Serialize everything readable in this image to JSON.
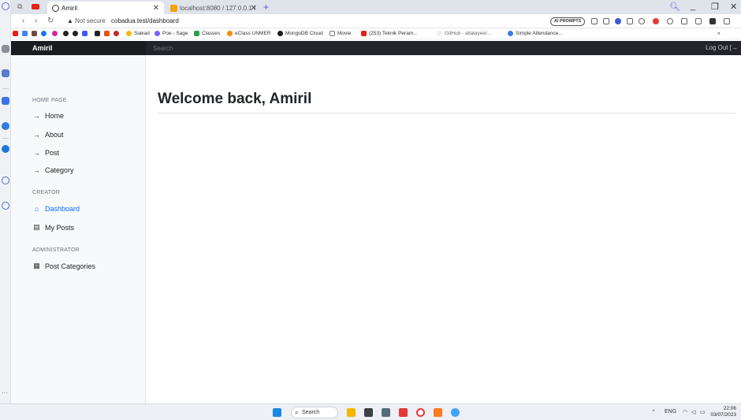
{
  "browser": {
    "tabs": [
      {
        "label": "Amiril",
        "active": true
      },
      {
        "label": "localhost:8080 / 127.0.0.1 /",
        "active": false
      }
    ],
    "address": {
      "security": "Not secure",
      "url": "cobadua.test/dashboard"
    },
    "ai_button": "AI PROMPTS",
    "bookmarks": [
      {
        "label": "Siakad",
        "color": "#f2b90f"
      },
      {
        "label": "Poe - Sage",
        "color": "#7b61ff"
      },
      {
        "label": "Classes",
        "color": "#2e9e44"
      },
      {
        "label": "eClass UNMER",
        "color": "#ff8a00"
      },
      {
        "label": "MongoDB Cloud",
        "color": "#1d1d1d"
      },
      {
        "label": "Movie",
        "color": "#777777"
      },
      {
        "label": "(253) Teknik Peram...",
        "color": "#e62117"
      },
      {
        "label": "GitHub - aliatayee/...",
        "color": "#cccccc"
      },
      {
        "label": "Simple Attendance...",
        "color": "#3d7be0"
      }
    ]
  },
  "app": {
    "brand": "Amiril",
    "search_placeholder": "Search",
    "logout": "Log Out",
    "sections": [
      {
        "heading": "HOME PAGE",
        "items": [
          {
            "label": "Home",
            "icon": "arrow-right-icon"
          },
          {
            "label": "About",
            "icon": "arrow-right-icon"
          },
          {
            "label": "Post",
            "icon": "arrow-right-icon"
          },
          {
            "label": "Category",
            "icon": "arrow-right-icon"
          }
        ]
      },
      {
        "heading": "CREATOR",
        "items": [
          {
            "label": "Dashboard",
            "icon": "home-icon",
            "active": true
          },
          {
            "label": "My Posts",
            "icon": "file-icon"
          }
        ]
      },
      {
        "heading": "ADMINISTRATOR",
        "items": [
          {
            "label": "Post Categories",
            "icon": "grid-icon"
          }
        ]
      }
    ],
    "main": {
      "title": "Welcome back, Amiril"
    }
  },
  "taskbar": {
    "search_label": "Search",
    "lang": "ENG",
    "time": "22:06",
    "date": "03/07/2023"
  }
}
